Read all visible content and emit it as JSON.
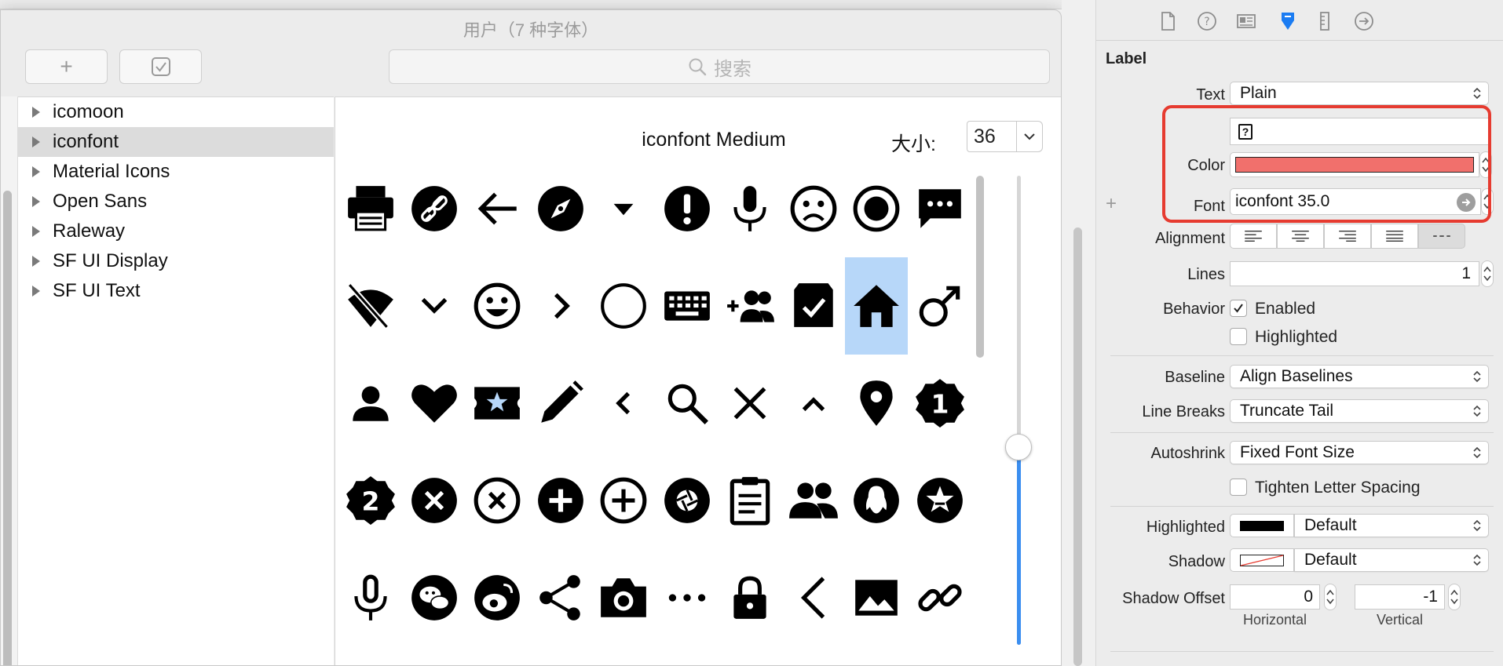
{
  "font_panel": {
    "title": "用户（7 种字体）",
    "add_button_symbol": "+",
    "search_placeholder": "搜索",
    "families": [
      {
        "label": "icomoon",
        "selected": false
      },
      {
        "label": "iconfont",
        "selected": true
      },
      {
        "label": "Material Icons",
        "selected": false
      },
      {
        "label": "Open Sans",
        "selected": false
      },
      {
        "label": "Raleway",
        "selected": false
      },
      {
        "label": "SF UI Display",
        "selected": false
      },
      {
        "label": "SF UI Text",
        "selected": false
      }
    ],
    "typeface_name": "iconfont Medium",
    "size_label": "大小:",
    "size_value": "36",
    "selected_glyph_index": 18,
    "glyphs": [
      "printer-icon",
      "link-circle-icon",
      "arrow-left-icon",
      "compass-icon",
      "caret-down-icon",
      "exclamation-circle-icon",
      "microphone-icon",
      "sad-face-icon",
      "radio-circle-icon",
      "chat-bubble-icon",
      "wifi-off-icon",
      "chevron-down-icon",
      "smile-icon",
      "chevron-right-icon",
      "circle-outline-icon",
      "keyboard-icon",
      "group-add-icon",
      "box-check-icon",
      "home-icon",
      "male-icon",
      "person-icon",
      "heart-icon",
      "ticket-star-icon",
      "pencil-icon",
      "chevron-left-small-icon",
      "search-icon",
      "close-x-icon",
      "chevron-up-icon",
      "map-pin-icon",
      "badge-one-icon",
      "badge-two-icon",
      "close-circle-filled-icon",
      "close-circle-outline-icon",
      "plus-circle-filled-icon",
      "plus-circle-outline-icon",
      "camera-shutter-icon",
      "clipboard-icon",
      "people-icon",
      "qq-penguin-icon",
      "star-circle-icon",
      "microphone-outline-icon",
      "wechat-icon",
      "weibo-icon",
      "share-icon",
      "camera-icon",
      "more-dots-icon",
      "lock-icon",
      "chevron-left-icon",
      "image-icon",
      "chain-link-icon"
    ]
  },
  "inspector": {
    "tabs": [
      "file-icon",
      "help-icon",
      "identity-icon",
      "attributes-icon",
      "size-ruler-icon",
      "connections-icon"
    ],
    "active_tab": "attributes-icon",
    "section_title": "Label",
    "text_label": "Text",
    "text_value": "Plain",
    "text_content": "?",
    "color_label": "Color",
    "color_value": "#f1706c",
    "font_label": "Font",
    "font_value": "iconfont 35.0",
    "plus_symbol": "+",
    "alignment_label": "Alignment",
    "alignment_options": [
      "left-align-icon",
      "center-align-icon",
      "right-align-icon",
      "justify-align-icon",
      "natural-align-icon"
    ],
    "lines_label": "Lines",
    "lines_value": "1",
    "behavior_label": "Behavior",
    "enabled_label": "Enabled",
    "enabled_checked": true,
    "highlighted_check_label": "Highlighted",
    "highlighted_checked": false,
    "baseline_label": "Baseline",
    "baseline_value": "Align Baselines",
    "line_breaks_label": "Line Breaks",
    "line_breaks_value": "Truncate Tail",
    "autoshrink_label": "Autoshrink",
    "autoshrink_value": "Fixed Font Size",
    "tighten_label": "Tighten Letter Spacing",
    "tighten_checked": false,
    "highlighted_label": "Highlighted",
    "highlighted_value": "Default",
    "highlighted_color": "#000000",
    "shadow_label": "Shadow",
    "shadow_value": "Default",
    "shadow_offset_label": "Shadow Offset",
    "shadow_horizontal": "0",
    "shadow_vertical": "-1",
    "horizontal_label": "Horizontal",
    "vertical_label": "Vertical",
    "accent_color": "#1b7cf2",
    "annotation_color": "#e63b30"
  }
}
